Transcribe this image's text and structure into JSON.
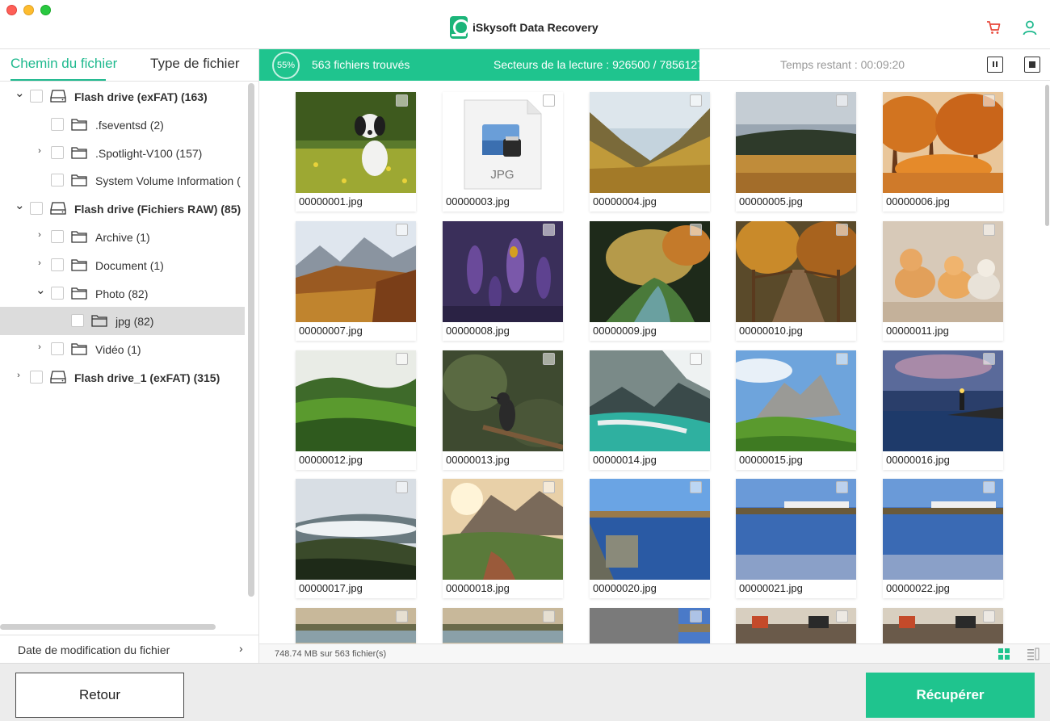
{
  "app": {
    "title": "iSkysoft Data Recovery"
  },
  "left_panel": {
    "tabs": [
      {
        "label": "Chemin du fichier",
        "active": true
      },
      {
        "label": "Type de fichier",
        "active": false
      }
    ],
    "tree": [
      {
        "label": "Flash drive (exFAT) (163)",
        "level": 0,
        "expander": "expanded",
        "icon": "drive-icon",
        "bold": true
      },
      {
        "label": ".fseventsd (2)",
        "level": 1,
        "expander": "none",
        "icon": "folder-icon"
      },
      {
        "label": ".Spotlight-V100 (157)",
        "level": 1,
        "expander": "collapsed",
        "icon": "folder-icon"
      },
      {
        "label": "System Volume Information (",
        "level": 1,
        "expander": "none",
        "icon": "folder-icon"
      },
      {
        "label": "Flash drive (Fichiers RAW) (85)",
        "level": 0,
        "expander": "expanded",
        "icon": "drive-icon",
        "bold": true
      },
      {
        "label": "Archive (1)",
        "level": 1,
        "expander": "collapsed",
        "icon": "folder-icon"
      },
      {
        "label": "Document (1)",
        "level": 1,
        "expander": "collapsed",
        "icon": "folder-icon"
      },
      {
        "label": "Photo (82)",
        "level": 1,
        "expander": "expanded",
        "icon": "folder-icon"
      },
      {
        "label": "jpg (82)",
        "level": 2,
        "expander": "none",
        "icon": "folder-icon",
        "selected": true
      },
      {
        "label": "Vidéo (1)",
        "level": 1,
        "expander": "collapsed",
        "icon": "folder-icon"
      },
      {
        "label": "Flash drive_1 (exFAT) (315)",
        "level": 0,
        "expander": "collapsed",
        "icon": "drive-icon",
        "bold": true
      }
    ],
    "sort_label": "Date de modification du fichier"
  },
  "scan": {
    "percent": "55%",
    "progress_fraction": 0.557,
    "found": "563 fichiers trouvés",
    "sectors": "Secteurs de la lecture : 926500 / 7856127",
    "remaining": "Temps restant : 00:09:20"
  },
  "files": [
    {
      "name": "00000001.jpg",
      "scene": "dog"
    },
    {
      "name": "00000003.jpg",
      "scene": "jpg-doc"
    },
    {
      "name": "00000004.jpg",
      "scene": "valley"
    },
    {
      "name": "00000005.jpg",
      "scene": "cloudy-field"
    },
    {
      "name": "00000006.jpg",
      "scene": "autumn"
    },
    {
      "name": "00000007.jpg",
      "scene": "mountain"
    },
    {
      "name": "00000008.jpg",
      "scene": "lavender"
    },
    {
      "name": "00000009.jpg",
      "scene": "forest-stream"
    },
    {
      "name": "00000010.jpg",
      "scene": "bridge"
    },
    {
      "name": "00000011.jpg",
      "scene": "cats"
    },
    {
      "name": "00000012.jpg",
      "scene": "tea-hill"
    },
    {
      "name": "00000013.jpg",
      "scene": "bird"
    },
    {
      "name": "00000014.jpg",
      "scene": "glacier-lake"
    },
    {
      "name": "00000015.jpg",
      "scene": "dolomites"
    },
    {
      "name": "00000016.jpg",
      "scene": "lighthouse"
    },
    {
      "name": "00000017.jpg",
      "scene": "foggy-hills"
    },
    {
      "name": "00000018.jpg",
      "scene": "sunrise-peaks"
    },
    {
      "name": "00000020.jpg",
      "scene": "river"
    },
    {
      "name": "00000021.jpg",
      "scene": "lake-town"
    },
    {
      "name": "00000022.jpg",
      "scene": "lake-town"
    },
    {
      "name": "",
      "scene": "lake-strip"
    },
    {
      "name": "",
      "scene": "lake-strip"
    },
    {
      "name": "",
      "scene": "gray-partial"
    },
    {
      "name": "",
      "scene": "room"
    },
    {
      "name": "",
      "scene": "room"
    }
  ],
  "status_bar": {
    "summary": "748.74 MB sur 563 fichier(s)"
  },
  "footer": {
    "back_label": "Retour",
    "recover_label": "Récupérer"
  },
  "colors": {
    "accent": "#1fc48e",
    "tab_active": "#1fb98e",
    "cart_icon": "#e8483b",
    "user_icon": "#1fb98e"
  }
}
